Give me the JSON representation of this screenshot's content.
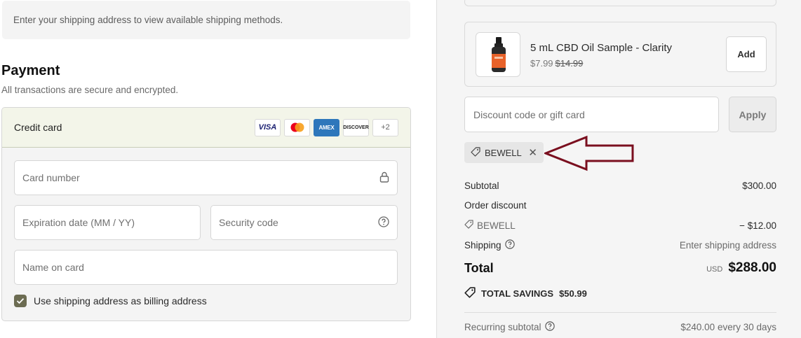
{
  "shipping": {
    "notice": "Enter your shipping address to view available shipping methods."
  },
  "payment": {
    "title": "Payment",
    "subtitle": "All transactions are secure and encrypted.",
    "method_label": "Credit card",
    "brands": [
      "VISA",
      "Mastercard",
      "AMEX",
      "DISCOVER"
    ],
    "more_brands": "+2",
    "card_number_placeholder": "Card number",
    "expiration_placeholder": "Expiration date (MM / YY)",
    "security_placeholder": "Security code",
    "name_placeholder": "Name on card",
    "billing_checkbox_label": "Use shipping address as billing address",
    "billing_checked": true
  },
  "upsell": {
    "title": "5 mL CBD Oil Sample - Clarity",
    "price": "$7.99",
    "compare_price": "$14.99",
    "add_label": "Add"
  },
  "discount": {
    "placeholder": "Discount code or gift card",
    "apply_label": "Apply",
    "applied_code": "BEWELL"
  },
  "summary": {
    "subtotal_label": "Subtotal",
    "subtotal_value": "$300.00",
    "order_discount_label": "Order discount",
    "discount_code": "BEWELL",
    "discount_value": "− $12.00",
    "shipping_label": "Shipping",
    "shipping_value": "Enter shipping address",
    "total_label": "Total",
    "currency": "USD",
    "total_value": "$288.00",
    "savings_label": "TOTAL SAVINGS",
    "savings_value": "$50.99",
    "recurring_label": "Recurring subtotal",
    "recurring_value": "$240.00 every 30 days"
  },
  "colors": {
    "accent_checkbox": "#6c6c52",
    "annotation_arrow": "#7a0f1f",
    "card_head_bg": "#f3f5e9"
  }
}
